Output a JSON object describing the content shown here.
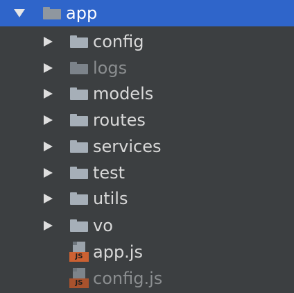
{
  "tree": {
    "root": {
      "label": "app",
      "expanded": true,
      "selected": true
    },
    "children": [
      {
        "label": "config",
        "type": "folder",
        "dim": false
      },
      {
        "label": "logs",
        "type": "folder",
        "dim": true
      },
      {
        "label": "models",
        "type": "folder",
        "dim": false
      },
      {
        "label": "routes",
        "type": "folder",
        "dim": false
      },
      {
        "label": "services",
        "type": "folder",
        "dim": false
      },
      {
        "label": "test",
        "type": "folder",
        "dim": false
      },
      {
        "label": "utils",
        "type": "folder",
        "dim": false
      },
      {
        "label": "vo",
        "type": "folder",
        "dim": false
      },
      {
        "label": "app.js",
        "type": "js-file",
        "dim": false,
        "badge": "JS"
      },
      {
        "label": "config.js",
        "type": "js-file",
        "dim": true,
        "badge": "JS"
      }
    ]
  },
  "icons": {
    "expanded": "triangle-down-icon",
    "collapsed": "triangle-right-icon",
    "folder": "folder-icon",
    "js_file": "javascript-file-icon"
  },
  "colors": {
    "background": "#3c3f41",
    "selection": "#2f65ca",
    "text": "#d9d9d9",
    "dim_text": "#8b8e90",
    "js_badge": "#cc6132"
  }
}
